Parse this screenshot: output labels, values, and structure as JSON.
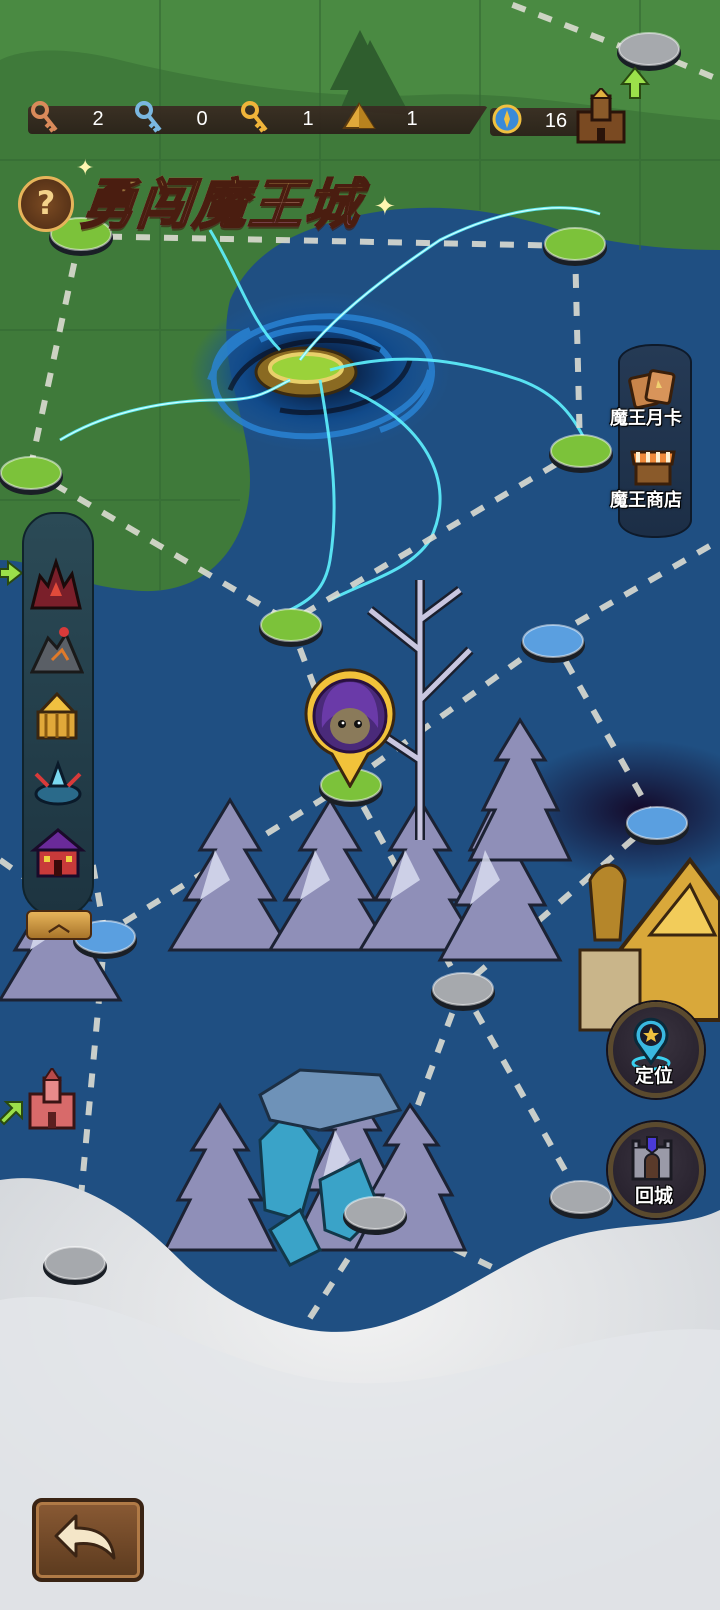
{
  "game": {
    "title": "勇闯魔王城",
    "help_symbol": "?",
    "accent_color": "#ffd75a"
  },
  "resources": [
    {
      "name": "bronze-key",
      "icon": "bronze-key-icon",
      "color": "#d98a5a",
      "value": "2"
    },
    {
      "name": "silver-key",
      "icon": "blue-key-icon",
      "color": "#7ab7e0",
      "value": "0"
    },
    {
      "name": "gold-key",
      "icon": "gold-key-icon",
      "color": "#f0b43a",
      "value": "1"
    },
    {
      "name": "pyramid",
      "icon": "pyramid-icon",
      "color": "#e0a83a",
      "value": "1"
    },
    {
      "name": "badge",
      "icon": "blue-badge-icon",
      "color": "#3a8ad8",
      "value": "16"
    }
  ],
  "side_menu": {
    "monthly_card": "魔王月卡",
    "shop": "魔王商店"
  },
  "left_menu": {
    "items": [
      "volcano-castle-icon",
      "dark-mountain-icon",
      "golden-temple-icon",
      "crystal-tower-icon",
      "haunted-house-icon"
    ],
    "collapse_symbol": "^"
  },
  "actions": {
    "locate": "定位",
    "return_city": "回城"
  },
  "map": {
    "node_colors": {
      "cleared": "#7cc23a",
      "available": "#5a9fe0",
      "locked": "#a6a9ad"
    }
  }
}
